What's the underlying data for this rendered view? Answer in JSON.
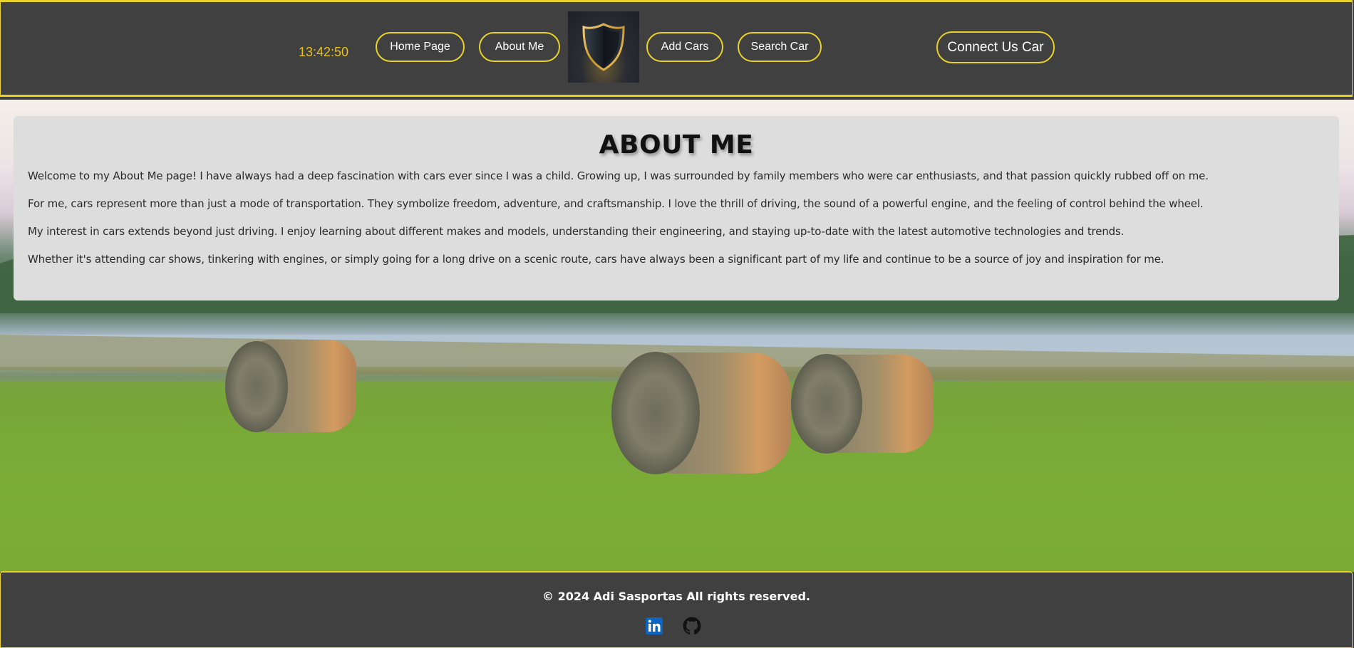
{
  "header": {
    "clock": "13:42:50",
    "nav": {
      "home": "Home Page",
      "about": "About Me",
      "add_cars": "Add Cars",
      "search_car": "Search Car"
    },
    "connect": "Connect Us Car"
  },
  "about": {
    "title": "ABOUT ME",
    "paragraphs": [
      "Welcome to my About Me page! I have always had a deep fascination with cars ever since I was a child. Growing up, I was surrounded by family members who were car enthusiasts, and that passion quickly rubbed off on me.",
      "For me, cars represent more than just a mode of transportation. They symbolize freedom, adventure, and craftsmanship. I love the thrill of driving, the sound of a powerful engine, and the feeling of control behind the wheel.",
      "My interest in cars extends beyond just driving. I enjoy learning about different makes and models, understanding their engineering, and staying up-to-date with the latest automotive technologies and trends.",
      "Whether it's attending car shows, tinkering with engines, or simply going for a long drive on a scenic route, cars have always been a significant part of my life and continue to be a source of joy and inspiration for me."
    ]
  },
  "footer": {
    "copyright": "© 2024 Adi Sasportas All rights reserved.",
    "social": [
      "linkedin-icon",
      "github-icon"
    ]
  },
  "colors": {
    "accent": "#e8d22a",
    "bar_background": "#404040",
    "card_background": "#dddddd",
    "clock": "#e8c21c"
  }
}
